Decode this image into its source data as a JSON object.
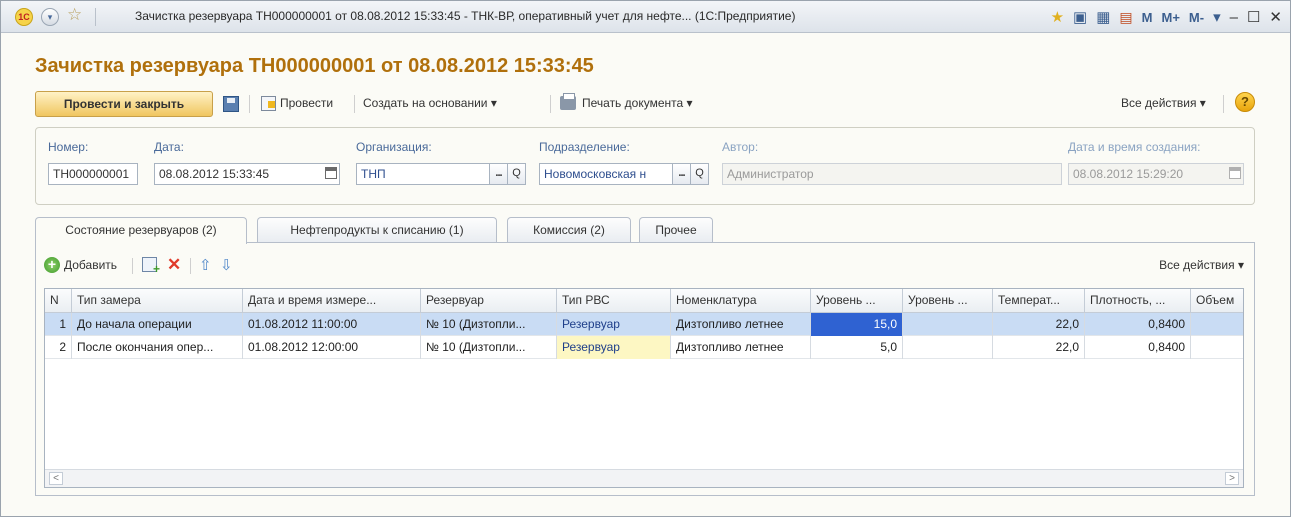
{
  "window": {
    "title": "Зачистка резервуара ТН000000001 от 08.08.2012 15:33:45 - ТНК-ВР, оперативный учет для нефте...  (1С:Предприятие)",
    "app_logo": "1С",
    "memory_buttons": [
      "M",
      "M+",
      "M-"
    ]
  },
  "document": {
    "title": "Зачистка резервуара ТН000000001 от 08.08.2012 15:33:45"
  },
  "toolbar": {
    "post_and_close": "Провести и закрыть",
    "post": "Провести",
    "create_based_on": "Создать на основании ▾",
    "print": "Печать документа ▾",
    "all_actions": "Все действия ▾",
    "help": "?"
  },
  "header": {
    "number_label": "Номер:",
    "number_value": "ТН000000001",
    "date_label": "Дата:",
    "date_value": "08.08.2012 15:33:45",
    "org_label": "Организация:",
    "org_value": "ТНП",
    "dept_label": "Подразделение:",
    "dept_value": "Новомосковская н",
    "author_label": "Автор:",
    "author_value": "Администратор",
    "created_label": "Дата и время создания:",
    "created_value": "08.08.2012 15:29:20"
  },
  "tabs": [
    "Состояние резервуаров (2)",
    "Нефтепродукты к списанию (1)",
    "Комиссия (2)",
    "Прочее"
  ],
  "table_toolbar": {
    "add": "Добавить",
    "all_actions": "Все действия ▾"
  },
  "table": {
    "columns": [
      "N",
      "Тип замера",
      "Дата и время измере...",
      "Резервуар",
      "Тип РВС",
      "Номенклатура",
      "Уровень ...",
      "Уровень ...",
      "Температ...",
      "Плотность, ...",
      "Объем"
    ],
    "rows": [
      [
        "1",
        "До начала операции",
        "01.08.2012 11:00:00",
        "№ 10 (Дизтопли...",
        "Резервуар",
        "Дизтопливо летнее",
        "15,0",
        "",
        "22,0",
        "0,8400",
        ""
      ],
      [
        "2",
        "После окончания опер...",
        "01.08.2012 12:00:00",
        "№ 10 (Дизтопли...",
        "Резервуар",
        "Дизтопливо летнее",
        "5,0",
        "",
        "22,0",
        "0,8400",
        ""
      ]
    ]
  },
  "colors": {
    "title_accent": "#b0700c",
    "selected_row": "#c9dcf4",
    "focus_cell": "#2f62d2"
  }
}
